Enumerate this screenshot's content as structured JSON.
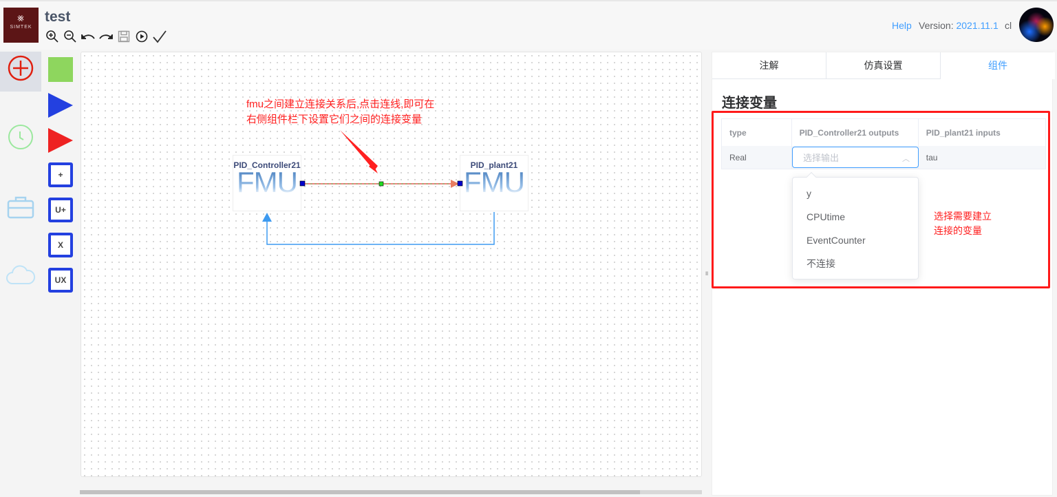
{
  "header": {
    "logo_text": "SIMTEK",
    "title": "test",
    "toolbar": [
      "zoom-in-icon",
      "zoom-out-icon",
      "undo-icon",
      "redo-icon",
      "save-icon",
      "run-icon",
      "check-icon"
    ],
    "help": "Help",
    "version_label": "Version:",
    "version": "2021.11.1",
    "user": "cl"
  },
  "sidebar": {
    "items": [
      "add-icon",
      "clock-icon",
      "toolbox-icon",
      "cloud-icon"
    ]
  },
  "palette": {
    "colors": {
      "green": "#8ed65e",
      "blue": "#2340e0",
      "red": "#ee2222"
    },
    "boxes": [
      "+",
      "U+",
      "X",
      "UX"
    ]
  },
  "canvas": {
    "annotation_line1": "fmu之间建立连接关系后,点击连线,即可在",
    "annotation_line2": "右侧组件栏下设置它们之间的连接变量",
    "blocks": [
      {
        "label": "PID_Controller21",
        "icon_text": "FMU"
      },
      {
        "label": "PID_plant21",
        "icon_text": "FMU"
      }
    ]
  },
  "panel": {
    "tabs": [
      {
        "label": "注解"
      },
      {
        "label": "仿真设置"
      },
      {
        "label": "组件",
        "active": true
      }
    ],
    "title": "连接变量",
    "table": {
      "headers": [
        "type",
        "PID_Controller21 outputs",
        "PID_plant21 inputs"
      ],
      "row": {
        "type": "Real",
        "select_placeholder": "选择输出",
        "input": "tau"
      }
    },
    "options": [
      "y",
      "CPUtime",
      "EventCounter",
      "不连接"
    ],
    "annotation_line1": "选择需要建立",
    "annotation_line2": "连接的变量"
  },
  "colors": {
    "accent": "#409eff",
    "annotation": "#ff2020"
  }
}
